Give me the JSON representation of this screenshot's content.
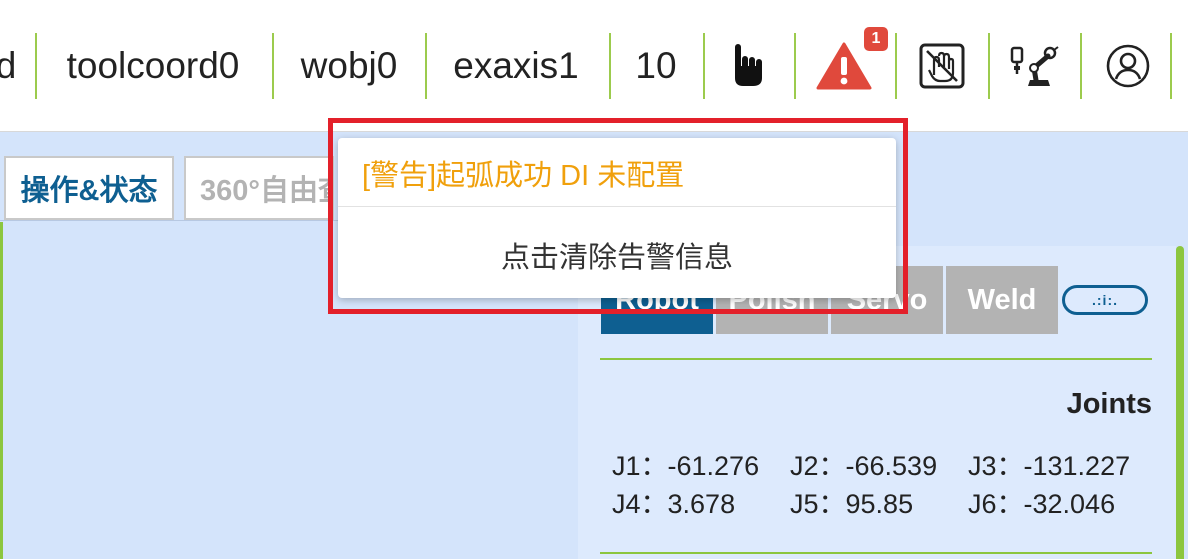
{
  "toolbar": {
    "cut_item": "d",
    "tool_coord": "toolcoord0",
    "wobj": "wobj0",
    "exaxis": "exaxis1",
    "speed": "10",
    "alarm_count": "1",
    "icons": [
      "hand-icon",
      "warning-icon",
      "no-drag-hand-icon",
      "robot-arm-icon",
      "user-icon"
    ],
    "accent_separator": "#9ccb4d"
  },
  "tabs": {
    "operation_status": "操作&状态",
    "free_view": "360°自由查"
  },
  "panel": {
    "tabs": [
      "Robot",
      "Polish",
      "Servo",
      "Weld"
    ],
    "toggle_label": ".:i:.",
    "joints_title": "Joints",
    "joints": [
      "J1：-61.276",
      "J2：-66.539",
      "J3：-131.227",
      "J4：3.678",
      "J5：95.85",
      "J6：-32.046"
    ]
  },
  "alert_popup": {
    "warning_text": "[警告]起弧成功 DI 未配置",
    "clear_text": "点击清除告警信息",
    "highlight_color": "#e3202a"
  },
  "colors": {
    "primary": "#0e5f91",
    "accent_green": "#8cc63f",
    "warning": "#f0a00c",
    "alarm_red": "#e0493c",
    "background": "#d4e4fb"
  }
}
